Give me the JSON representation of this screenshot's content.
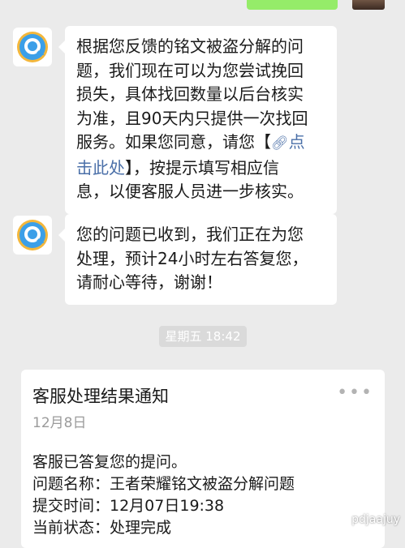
{
  "messages": [
    {
      "avatar_icon": "qq-service-icon",
      "segments": [
        {
          "text": "根据您反馈的铭文被盗分解的问"
        },
        {
          "text": "题，我们现在可以为您尝试挽回"
        },
        {
          "text": "损失，具体找回数量以后台核实"
        },
        {
          "text": "为准，且90天内只提供一次找回"
        },
        {
          "pre": "服务。如果您同意，请您【",
          "link_icon": "link-icon",
          "link": "点"
        },
        {
          "link": "击此处",
          "post": "】，按提示填写相应信"
        },
        {
          "text": "息，以便客服人员进一步核实。"
        }
      ]
    },
    {
      "avatar_icon": "qq-service-icon",
      "segments": [
        {
          "text": "您的问题已收到，我们正在为您"
        },
        {
          "text": "处理，预计24小时左右答复您，"
        },
        {
          "text": "请耐心等待，谢谢！"
        }
      ]
    }
  ],
  "timestamp": "星期五 18:42",
  "card": {
    "title": "客服处理结果通知",
    "date": "12月8日",
    "lines": [
      "客服已答复您的提问。",
      "问题名称：王者荣耀铭文被盗分解问题",
      "提交时间：12月07日19:38",
      "当前状态：处理完成"
    ],
    "more_icon": "more-dots-icon"
  },
  "watermark": "pdjaajuy",
  "colors": {
    "background": "#ebebeb",
    "bubble": "#ffffff",
    "link": "#4a6fa8",
    "sent_bubble": "#95ec69",
    "avatar_blue": "#3b9fe8",
    "avatar_yellow": "#f4b73b"
  }
}
